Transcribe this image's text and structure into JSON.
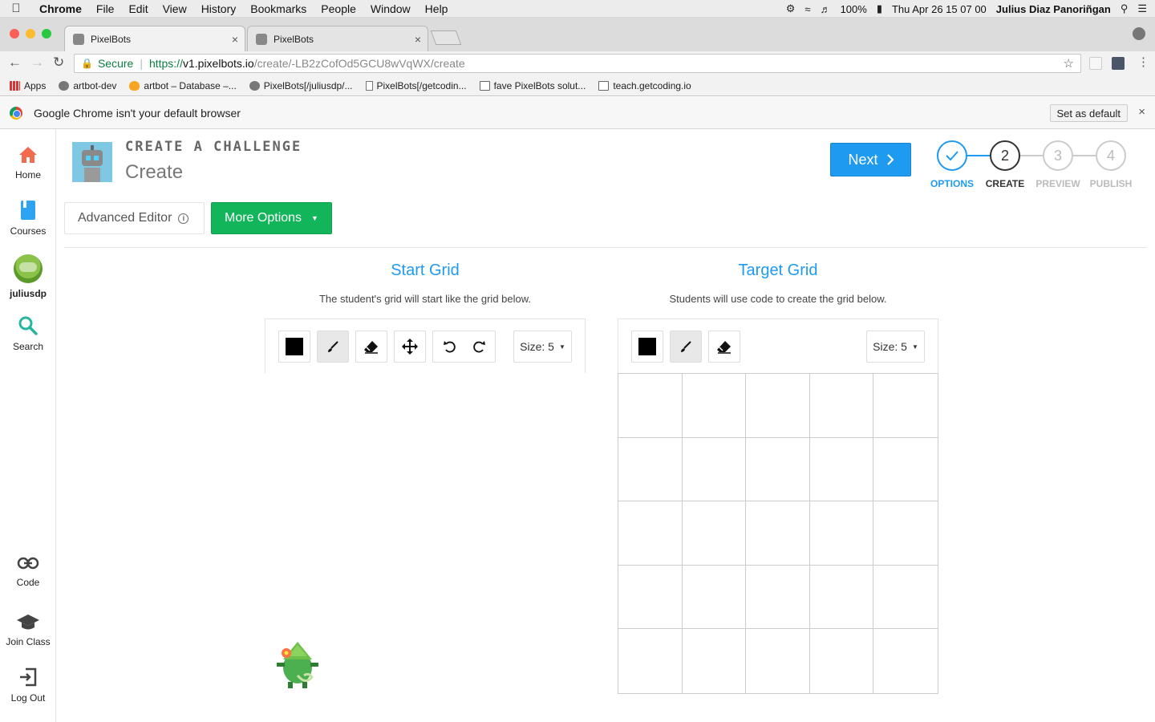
{
  "os_menubar": {
    "app_name": "Chrome",
    "menus": [
      "File",
      "Edit",
      "View",
      "History",
      "Bookmarks",
      "People",
      "Window",
      "Help"
    ],
    "battery": "100%",
    "clock": "Thu Apr 26  15 07 00",
    "user": "Julius Diaz Panoriñgan"
  },
  "browser": {
    "tabs": [
      {
        "title": "PixelBots",
        "active": true
      },
      {
        "title": "PixelBots",
        "active": false
      }
    ],
    "secure_label": "Secure",
    "url_scheme": "https://",
    "url_host": "v1.pixelbots.io",
    "url_path": "/create/-LB2zCofOd5GCU8wVqWX/create",
    "bookmarks": [
      {
        "label": "Apps",
        "icon": "apps-grid-icon"
      },
      {
        "label": "artbot-dev",
        "icon": "robot-icon"
      },
      {
        "label": "artbot – Database –...",
        "icon": "firebase-icon"
      },
      {
        "label": "PixelBots[/juliusdp/...",
        "icon": "robot-icon"
      },
      {
        "label": "PixelBots[/getcodin...",
        "icon": "page-icon"
      },
      {
        "label": "fave PixelBots solut...",
        "icon": "folder-icon"
      },
      {
        "label": "teach.getcoding.io",
        "icon": "folder-icon"
      }
    ],
    "infobar_text": "Google Chrome isn't your default browser",
    "infobar_button": "Set as default"
  },
  "sidebar": {
    "items_top": [
      {
        "label": "Home",
        "icon": "home-icon"
      },
      {
        "label": "Courses",
        "icon": "book-icon"
      },
      {
        "label": "juliusdp",
        "icon": "avatar"
      },
      {
        "label": "Search",
        "icon": "search-icon"
      }
    ],
    "items_bottom": [
      {
        "label": "Code",
        "icon": "link-icon"
      },
      {
        "label": "Join Class",
        "icon": "graduation-cap-icon"
      },
      {
        "label": "Log Out",
        "icon": "logout-icon"
      }
    ]
  },
  "header": {
    "kicker": "CREATE A CHALLENGE",
    "title": "Create",
    "next_label": "Next"
  },
  "stepper": [
    {
      "number": "✓",
      "label": "OPTIONS",
      "state": "done"
    },
    {
      "number": "2",
      "label": "CREATE",
      "state": "active"
    },
    {
      "number": "3",
      "label": "PREVIEW",
      "state": "pending"
    },
    {
      "number": "4",
      "label": "PUBLISH",
      "state": "pending"
    }
  ],
  "options": {
    "advanced_editor": "Advanced Editor",
    "more_options": "More Options"
  },
  "start_grid": {
    "title": "Start Grid",
    "description": "The student's grid will start like the grid below.",
    "tools": [
      "color-swatch",
      "paintbrush-icon",
      "eraser-icon",
      "move-icon",
      "rotate-ccw-icon",
      "rotate-cw-icon"
    ],
    "selected_color": "#000000",
    "size_label": "Size: 5"
  },
  "target_grid": {
    "title": "Target Grid",
    "description": "Students will use code to create the grid below.",
    "tools": [
      "color-swatch",
      "paintbrush-icon",
      "eraser-icon"
    ],
    "selected_color": "#000000",
    "size_label": "Size: 5",
    "rows": 5,
    "cols": 5
  },
  "colors": {
    "accent_blue": "#1e9bf0",
    "green_button": "#13b55a",
    "home_icon": "#f26b4f",
    "courses_icon": "#2ea3f2",
    "search_icon": "#26b5a0"
  }
}
